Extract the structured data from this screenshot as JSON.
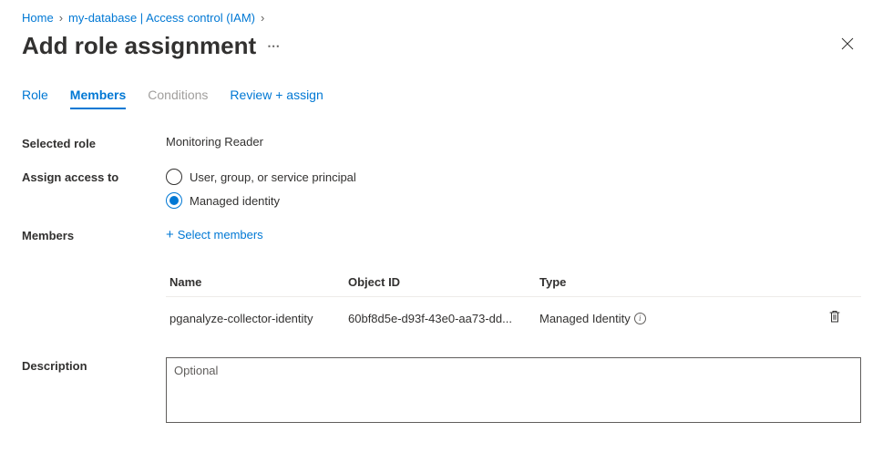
{
  "breadcrumb": {
    "home": "Home",
    "resource": "my-database | Access control (IAM)"
  },
  "page_title": "Add role assignment",
  "tabs": {
    "role": "Role",
    "members": "Members",
    "conditions": "Conditions",
    "review": "Review + assign"
  },
  "labels": {
    "selected_role": "Selected role",
    "assign_access_to": "Assign access to",
    "members": "Members",
    "description": "Description"
  },
  "selected_role_value": "Monitoring Reader",
  "access_options": {
    "user_group": "User, group, or service principal",
    "managed_identity": "Managed identity"
  },
  "select_members_label": "Select members",
  "table": {
    "headers": {
      "name": "Name",
      "object_id": "Object ID",
      "type": "Type"
    },
    "rows": [
      {
        "name": "pganalyze-collector-identity",
        "object_id": "60bf8d5e-d93f-43e0-aa73-dd...",
        "type": "Managed Identity"
      }
    ]
  },
  "description_placeholder": "Optional"
}
